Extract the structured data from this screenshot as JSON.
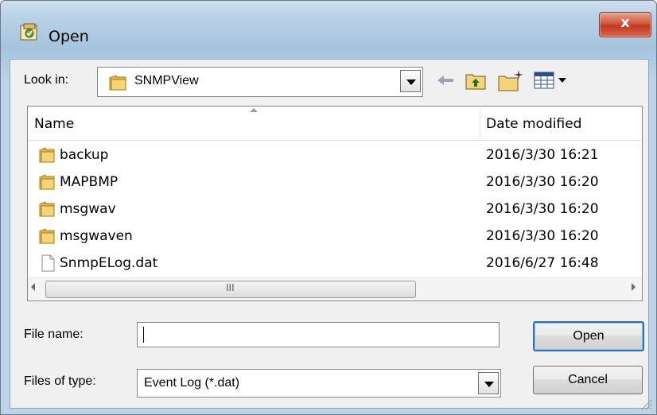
{
  "window": {
    "title": "Open",
    "close_glyph": "x",
    "icon": "open-file-app-icon"
  },
  "toolbar": {
    "look_in_label": "Look in:",
    "look_in_value": "SNMPView",
    "buttons": [
      "back-arrow-icon",
      "up-folder-icon",
      "new-folder-icon",
      "view-menu-icon"
    ]
  },
  "list": {
    "columns": {
      "name": "Name",
      "date": "Date modified"
    },
    "rows": [
      {
        "name": "backup",
        "date": "2016/3/30 16:21",
        "icon": "folder-icon"
      },
      {
        "name": "MAPBMP",
        "date": "2016/3/30 16:20",
        "icon": "folder-icon"
      },
      {
        "name": "msgwav",
        "date": "2016/3/30 16:20",
        "icon": "folder-icon"
      },
      {
        "name": "msgwaven",
        "date": "2016/3/30 16:20",
        "icon": "folder-icon"
      },
      {
        "name": "SnmpELog.dat",
        "date": "2016/6/27 16:48",
        "icon": "file-icon"
      }
    ],
    "scroll_grip": "III"
  },
  "form": {
    "file_name_label": "File name:",
    "file_name_value": "",
    "file_type_label": "Files of type:",
    "file_type_value": "Event Log (*.dat)"
  },
  "buttons": {
    "open": "Open",
    "cancel": "Cancel"
  },
  "colors": {
    "folder": "#e8b93c",
    "accent": "#2f6fb6",
    "close": "#c3381f"
  }
}
